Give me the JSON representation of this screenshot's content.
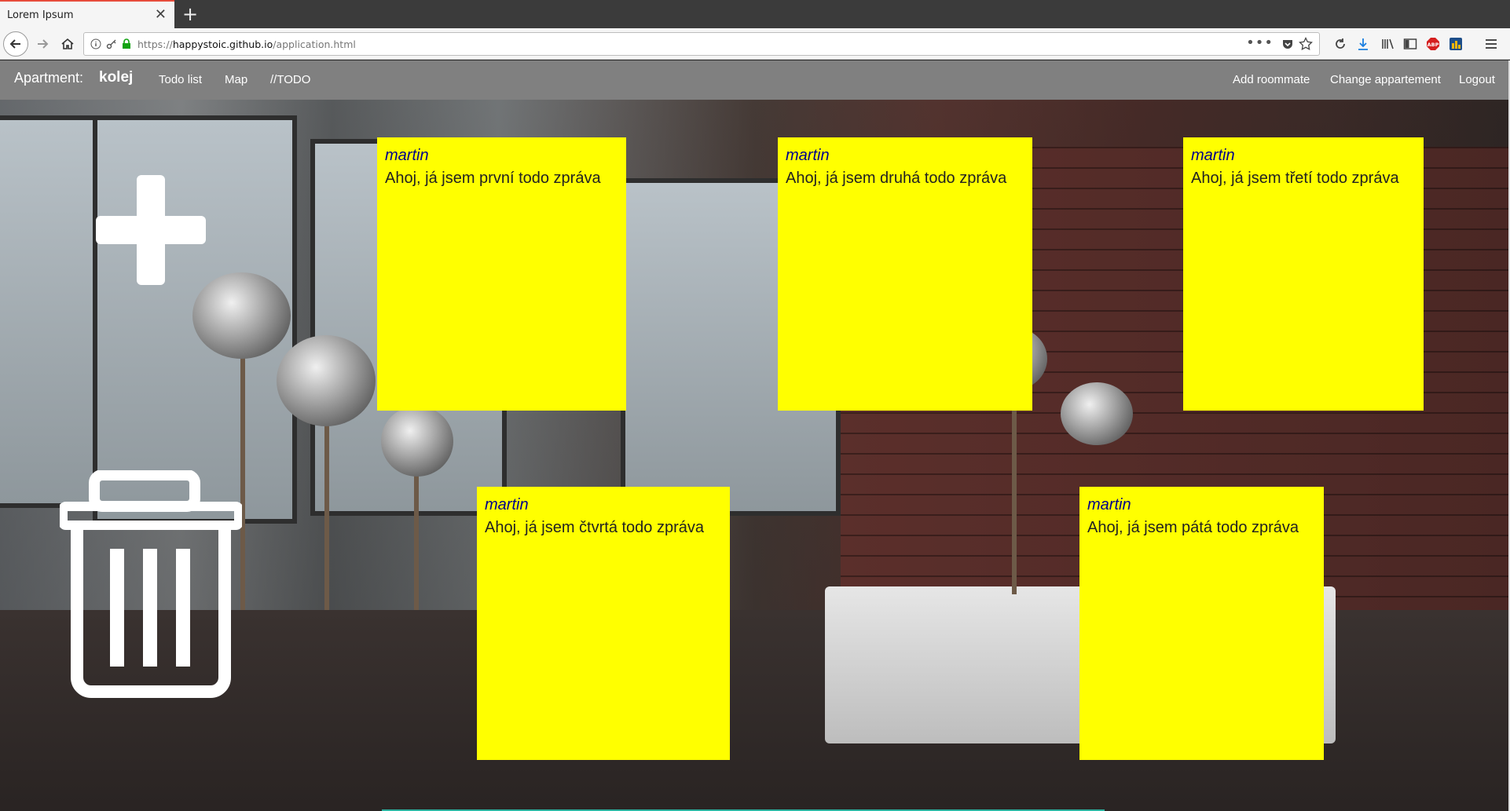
{
  "browser": {
    "tab_title": "Lorem Ipsum",
    "tab_close_icon": "close-icon",
    "new_tab_icon": "plus-icon",
    "url_scheme": "https://",
    "url_host": "happystoic.github.io",
    "url_path": "/application.html",
    "icons": [
      "back-icon",
      "forward-icon",
      "home-icon",
      "info-icon",
      "key-icon",
      "lock-icon",
      "more-icon",
      "pocket-icon",
      "star-icon",
      "reload-icon",
      "download-icon",
      "library-icon",
      "sidebar-icon",
      "adblock-icon",
      "extension-icon",
      "menu-icon"
    ],
    "adblock_label": "ABP"
  },
  "nav": {
    "apartment_label": "Apartment:",
    "apartment_name": "kolej",
    "todo_list": "Todo list",
    "map": "Map",
    "todo": "//TODO",
    "add_roommate": "Add roommate",
    "change_apartment": "Change appartement",
    "logout": "Logout"
  },
  "actions": {
    "add_icon": "plus-icon",
    "delete_icon": "trash-icon"
  },
  "notes": [
    {
      "author": "martin",
      "text": "Ahoj, já jsem první todo zpráva"
    },
    {
      "author": "martin",
      "text": "Ahoj, já jsem druhá todo zpráva"
    },
    {
      "author": "martin",
      "text": "Ahoj, já jsem třetí todo zpráva"
    },
    {
      "author": "martin",
      "text": "Ahoj, já jsem čtvrtá todo zpráva"
    },
    {
      "author": "martin",
      "text": "Ahoj, já jsem pátá todo zpráva"
    }
  ],
  "colors": {
    "note_bg": "#ffff00",
    "note_author": "#00008b",
    "topnav_bg": "#808080",
    "tab_accent": "#e74c3c"
  }
}
